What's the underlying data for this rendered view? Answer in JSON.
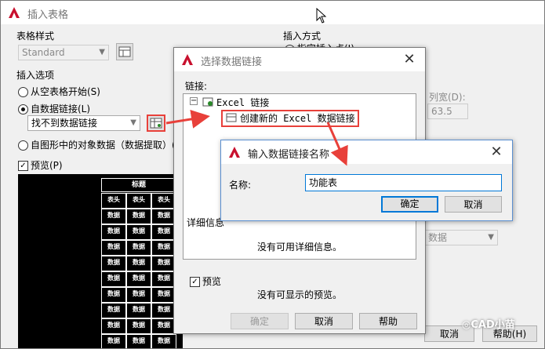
{
  "main": {
    "title": "插入表格",
    "table_style_label": "表格样式",
    "table_style_value": "Standard",
    "insert_options_label": "插入选项",
    "radio_empty": "从空表格开始(S)",
    "radio_datalink": "自数据链接(L)",
    "datalink_value": "找不到数据链接",
    "radio_extract": "自图形中的对象数据（数据提取）(X)",
    "preview_check": "预览(P)",
    "insert_method_label": "插入方式",
    "insert_point": "指定插入点(I)",
    "col_width_label": "列宽(D):",
    "col_width_value": "63.5",
    "data_combo": "数据",
    "cancel": "取消",
    "help": "帮助(H)",
    "preview_table": {
      "title": "标题",
      "header": [
        "表头",
        "表头",
        "表头"
      ],
      "cell": "数据"
    }
  },
  "select_link": {
    "title": "选择数据链接",
    "links_label": "链接:",
    "tree_root": "Excel 链接",
    "tree_item": "创建新的 Excel 数据链接",
    "detail_label": "详细信息",
    "no_detail": "没有可用详细信息。",
    "preview_check": "预览",
    "no_preview": "没有可显示的预览。",
    "ok": "确定",
    "cancel": "取消",
    "help": "帮助"
  },
  "name_dialog": {
    "title": "输入数据链接名称",
    "name_label": "名称:",
    "name_value": "功能表",
    "ok": "确定",
    "cancel": "取消"
  },
  "watermark": "CAD小苗",
  "colors": {
    "accent": "#0078d7",
    "arrow": "#e8403a",
    "logo": "#c8102e"
  }
}
